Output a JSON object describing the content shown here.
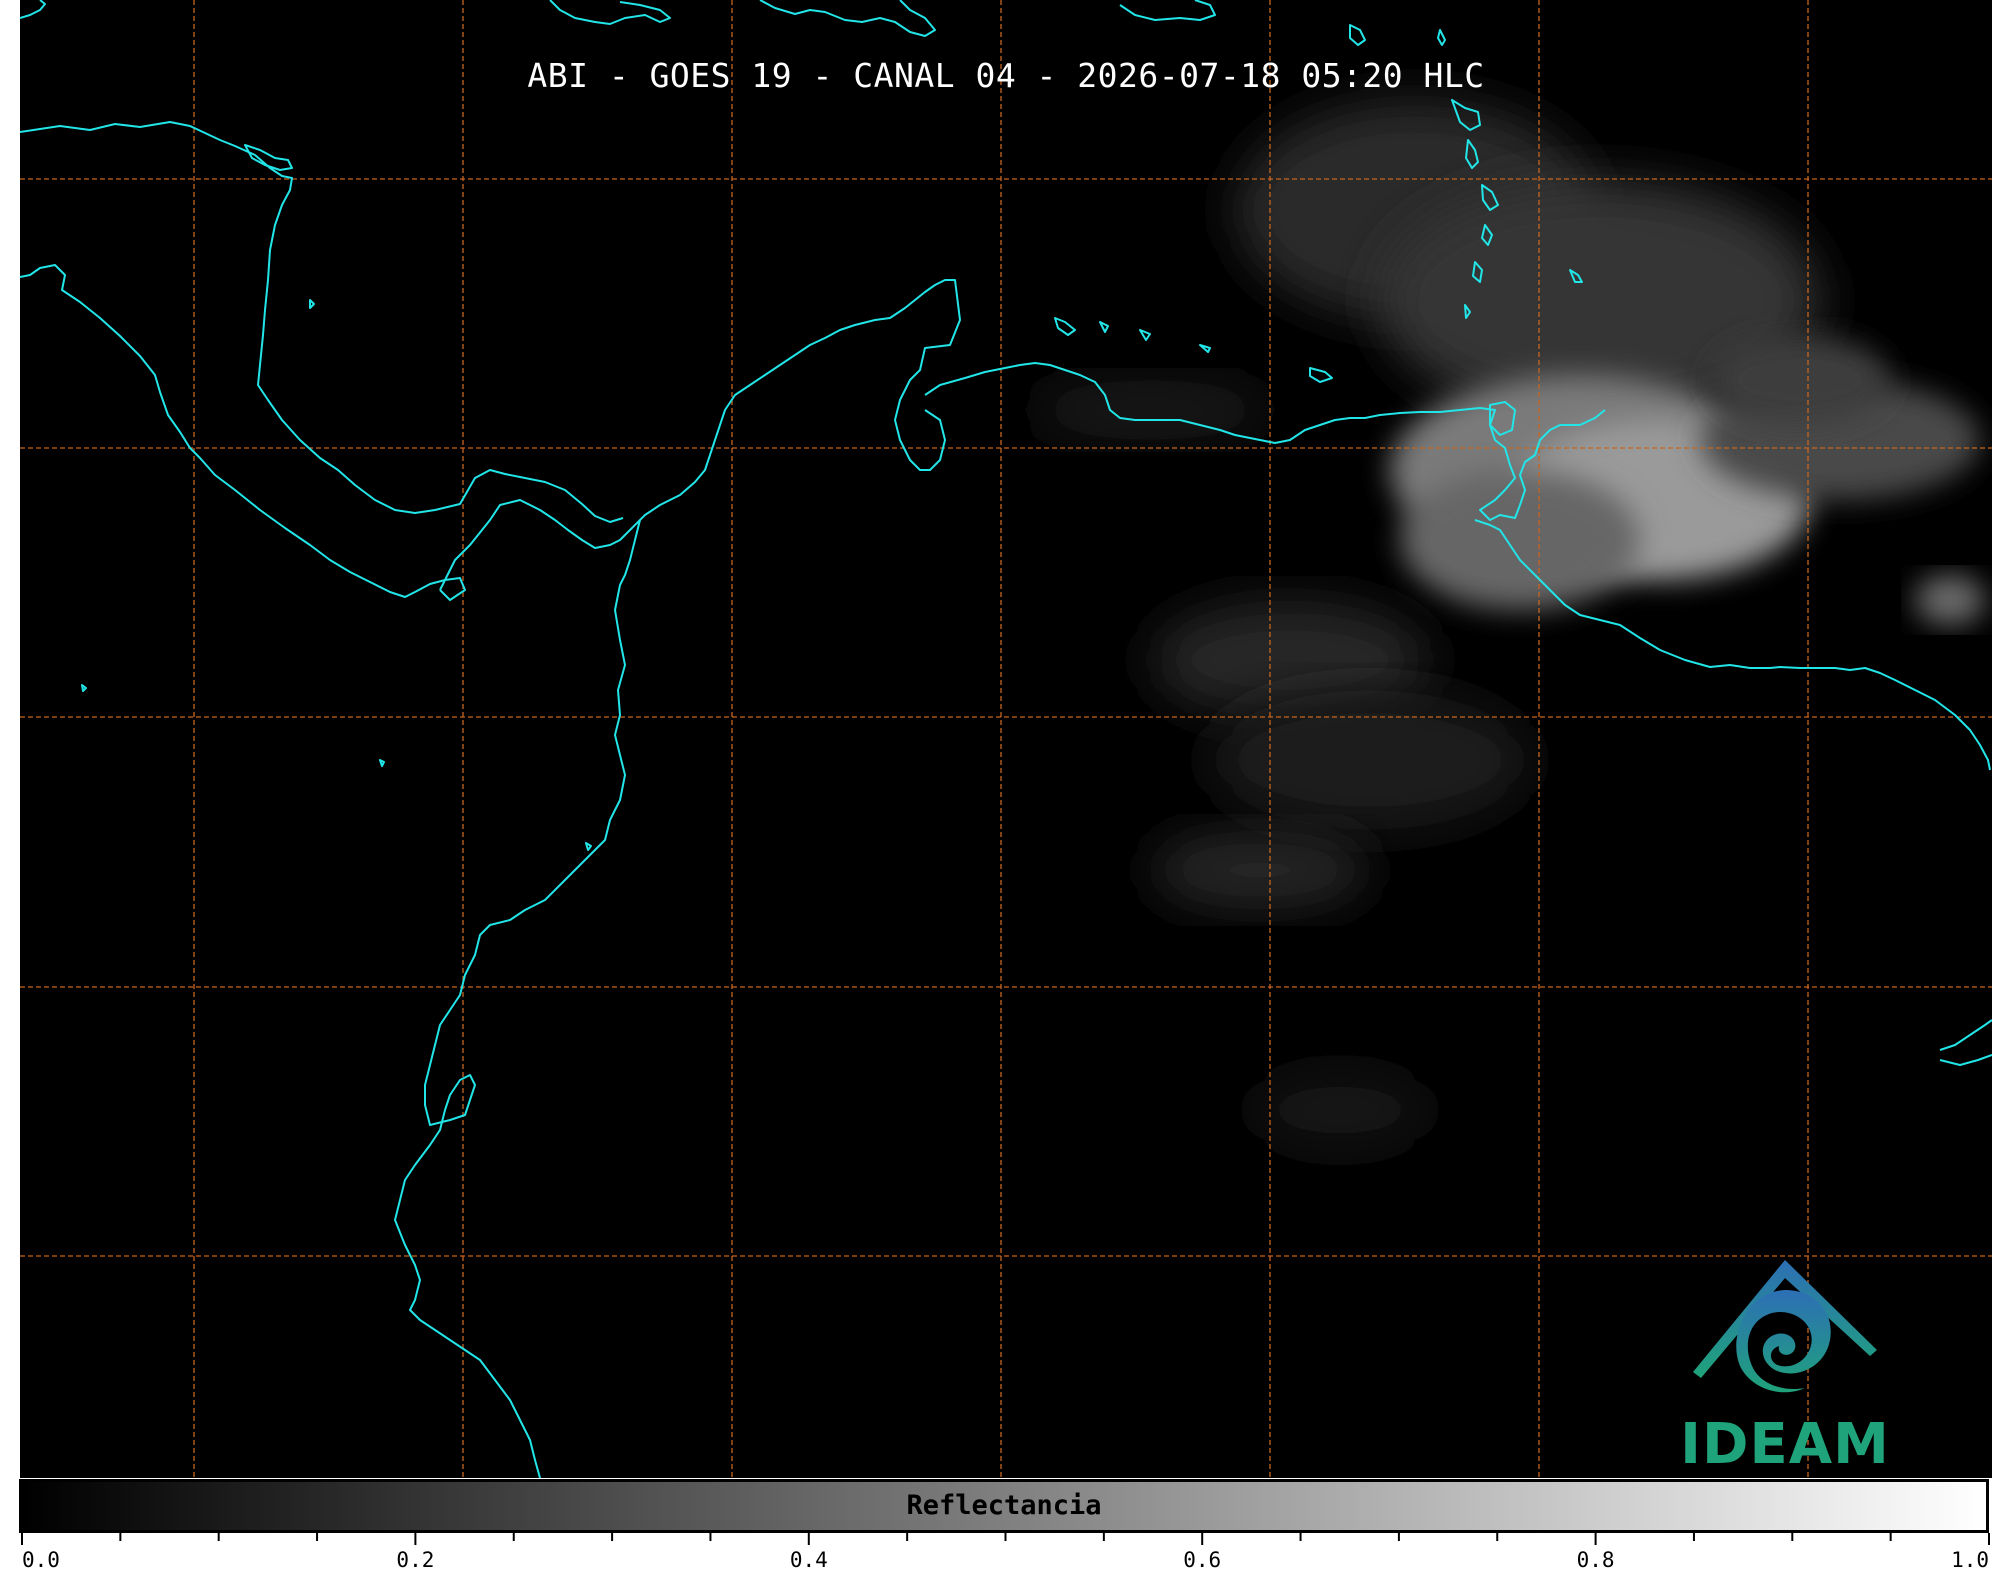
{
  "title": "ABI - GOES 19 - CANAL 04 - 2026-07-18 05:20 HLC",
  "logo": {
    "text": "IDEAM",
    "icon": "ideam-logo-icon"
  },
  "colors": {
    "background": "#000000",
    "coastline": "#22e5e8",
    "gridline": "#c8641e",
    "cloud": "#bdbdbd",
    "logo_green": "#1fa37a",
    "logo_blue": "#2d6fb5"
  },
  "colorbar": {
    "label": "Reflectancia",
    "min": 0.0,
    "max": 1.0,
    "colormap": "grayscale",
    "tick_labels": [
      "0.0",
      "0.2",
      "0.4",
      "0.6",
      "0.8",
      "1.0"
    ],
    "minor_ticks_per_interval": 4
  }
}
